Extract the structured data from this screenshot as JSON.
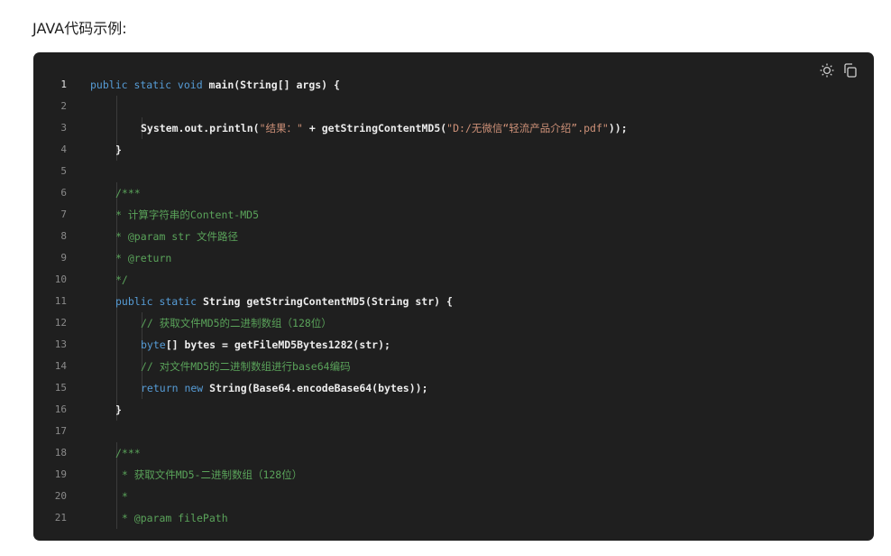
{
  "heading": "JAVA代码示例:",
  "colors": {
    "keyword": "#569cd6",
    "string": "#ce9178",
    "comment": "#5aa35a",
    "text": "#e3e3e3",
    "background": "#1f1f1f"
  },
  "toolbar": {
    "icons": [
      "sun-icon",
      "copy-icon"
    ]
  },
  "code_lines": [
    {
      "n": "1",
      "indent": 0,
      "tokens": [
        [
          "public static void",
          "kw"
        ],
        [
          " main(String[] args) {",
          "fn"
        ]
      ]
    },
    {
      "n": "2",
      "indent": 1,
      "tokens": []
    },
    {
      "n": "3",
      "indent": 2,
      "tokens": [
        [
          "System.out.println(",
          "fn"
        ],
        [
          "\"结果：\"",
          "str"
        ],
        [
          " + getStringContentMD5(",
          "fn"
        ],
        [
          "\"D:/无微信“轻流产品介绍”.pdf\"",
          "str"
        ],
        [
          "));",
          "fn"
        ]
      ]
    },
    {
      "n": "4",
      "indent": 1,
      "tokens": [
        [
          "}",
          "fn"
        ]
      ]
    },
    {
      "n": "5",
      "indent": 0,
      "tokens": []
    },
    {
      "n": "6",
      "indent": 1,
      "tokens": [
        [
          "/***",
          "com"
        ]
      ]
    },
    {
      "n": "7",
      "indent": 1,
      "tokens": [
        [
          "* 计算字符串的Content-MD5",
          "com"
        ]
      ]
    },
    {
      "n": "8",
      "indent": 1,
      "tokens": [
        [
          "* @param str 文件路径",
          "com"
        ]
      ]
    },
    {
      "n": "9",
      "indent": 1,
      "tokens": [
        [
          "* @return",
          "com"
        ]
      ]
    },
    {
      "n": "10",
      "indent": 1,
      "tokens": [
        [
          "*/",
          "com"
        ]
      ]
    },
    {
      "n": "11",
      "indent": 1,
      "tokens": [
        [
          "public static",
          "kw"
        ],
        [
          " String getStringContentMD5(String str) {",
          "fn"
        ]
      ]
    },
    {
      "n": "12",
      "indent": 2,
      "tokens": [
        [
          "// 获取文件MD5的二进制数组（128位）",
          "com"
        ]
      ]
    },
    {
      "n": "13",
      "indent": 2,
      "tokens": [
        [
          "byte",
          "kw"
        ],
        [
          "[] bytes = getFileMD5Bytes1282(str);",
          "fn"
        ]
      ]
    },
    {
      "n": "14",
      "indent": 2,
      "tokens": [
        [
          "// 对文件MD5的二进制数组进行base64编码",
          "com"
        ]
      ]
    },
    {
      "n": "15",
      "indent": 2,
      "tokens": [
        [
          "return new",
          "kw"
        ],
        [
          " String(Base64.encodeBase64(bytes));",
          "fn"
        ]
      ]
    },
    {
      "n": "16",
      "indent": 1,
      "tokens": [
        [
          "}",
          "fn"
        ]
      ]
    },
    {
      "n": "17",
      "indent": 0,
      "tokens": []
    },
    {
      "n": "18",
      "indent": 1,
      "tokens": [
        [
          "/***",
          "com"
        ]
      ]
    },
    {
      "n": "19",
      "indent": 1,
      "tokens": [
        [
          " * 获取文件MD5-二进制数组（128位）",
          "com"
        ]
      ]
    },
    {
      "n": "20",
      "indent": 1,
      "tokens": [
        [
          " *",
          "com"
        ]
      ]
    },
    {
      "n": "21",
      "indent": 1,
      "tokens": [
        [
          " * @param filePath",
          "com"
        ]
      ]
    }
  ]
}
